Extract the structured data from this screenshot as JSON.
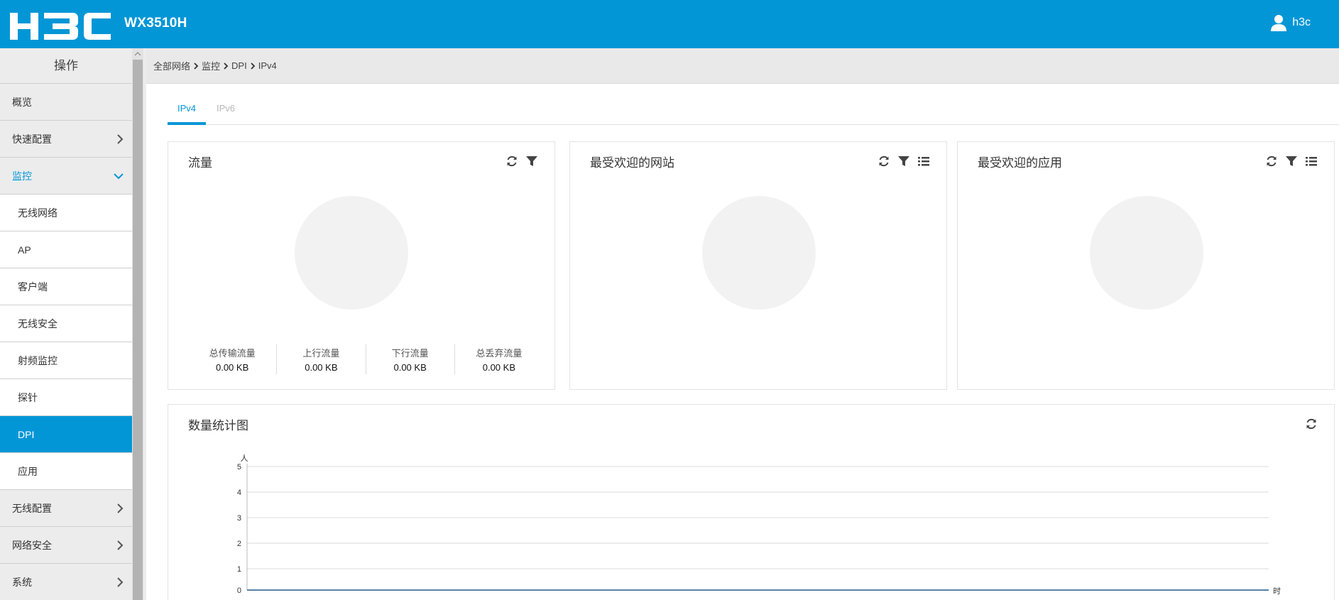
{
  "header": {
    "logo_text": "H3C",
    "model": "WX3510H",
    "username": "h3c"
  },
  "sidebar": {
    "title": "操作",
    "items": [
      {
        "label": "概览",
        "level": "top",
        "chevron": ""
      },
      {
        "label": "快速配置",
        "level": "top",
        "chevron": "right"
      },
      {
        "label": "监控",
        "level": "top",
        "chevron": "down",
        "state": "expanded"
      },
      {
        "label": "无线网络",
        "level": "sub"
      },
      {
        "label": "AP",
        "level": "sub"
      },
      {
        "label": "客户端",
        "level": "sub"
      },
      {
        "label": "无线安全",
        "level": "sub"
      },
      {
        "label": "射频监控",
        "level": "sub"
      },
      {
        "label": "探针",
        "level": "sub"
      },
      {
        "label": "DPI",
        "level": "sub",
        "state": "active"
      },
      {
        "label": "应用",
        "level": "sub"
      },
      {
        "label": "无线配置",
        "level": "top",
        "chevron": "right"
      },
      {
        "label": "网络安全",
        "level": "top",
        "chevron": "right"
      },
      {
        "label": "系统",
        "level": "top",
        "chevron": "right"
      }
    ]
  },
  "breadcrumb": [
    "全部网络",
    "监控",
    "DPI",
    "IPv4"
  ],
  "tabs": [
    {
      "label": "IPv4",
      "active": true
    },
    {
      "label": "IPv6",
      "active": false
    }
  ],
  "cards": {
    "traffic": {
      "title": "流量",
      "stats": [
        {
          "label": "总传输流量",
          "value": "0.00 KB"
        },
        {
          "label": "上行流量",
          "value": "0.00 KB"
        },
        {
          "label": "下行流量",
          "value": "0.00 KB"
        },
        {
          "label": "总丢弃流量",
          "value": "0.00 KB"
        }
      ]
    },
    "sites": {
      "title": "最受欢迎的网站"
    },
    "apps": {
      "title": "最受欢迎的应用"
    },
    "stats_chart": {
      "title": "数量统计图"
    }
  },
  "chart_data": {
    "type": "line",
    "title": "数量统计图",
    "ylabel": "人",
    "xlabel": "时",
    "y_ticks": [
      "0",
      "1",
      "2",
      "3",
      "4",
      "5"
    ],
    "ylim": [
      0,
      5
    ],
    "grid": true,
    "series": [
      {
        "values": [
          0,
          0
        ]
      }
    ]
  },
  "colors": {
    "primary": "#0396d6",
    "sidebar_bg": "#ececec",
    "donut": "#f2f2f2"
  },
  "icons": {
    "refresh": "refresh-icon",
    "filter": "filter-icon",
    "list": "list-icon",
    "user": "user-icon"
  }
}
